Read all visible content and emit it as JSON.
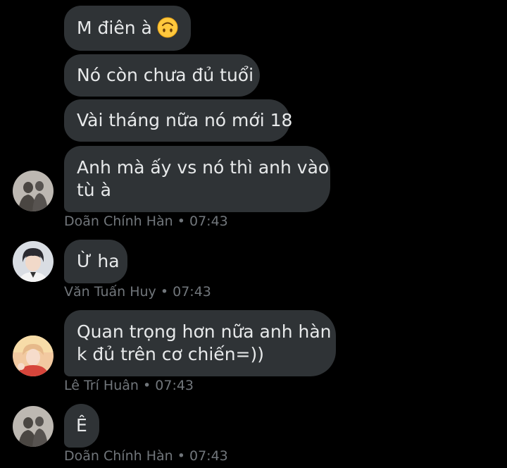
{
  "groups": [
    {
      "messages": [
        {
          "text": "M điên à",
          "emoji": "upside-down-face"
        },
        {
          "text": "Nó còn chưa đủ tuổi"
        },
        {
          "text": "Vài tháng nữa nó mới 18"
        },
        {
          "line1": "Anh mà ấy vs nó thì anh vào",
          "line2": "tù à"
        }
      ],
      "sender": "Doãn Chính Hàn",
      "time": "07:43"
    },
    {
      "messages": [
        {
          "text": "Ừ ha"
        }
      ],
      "sender": "Văn Tuấn Huy",
      "time": "07:43"
    },
    {
      "messages": [
        {
          "line1": "Quan trọng hơn nữa anh hàn",
          "line2": "k đủ trên cơ chiến=))"
        }
      ],
      "sender": "Lê Trí Huân",
      "time": "07:43"
    },
    {
      "messages": [
        {
          "text": "Ê"
        }
      ],
      "sender": "Doãn Chính Hàn",
      "time": "07:43"
    }
  ],
  "separator": "•",
  "colors": {
    "background": "#000000",
    "bubble": "#2f3336",
    "text": "#e7e9ea",
    "meta": "#71767b"
  }
}
